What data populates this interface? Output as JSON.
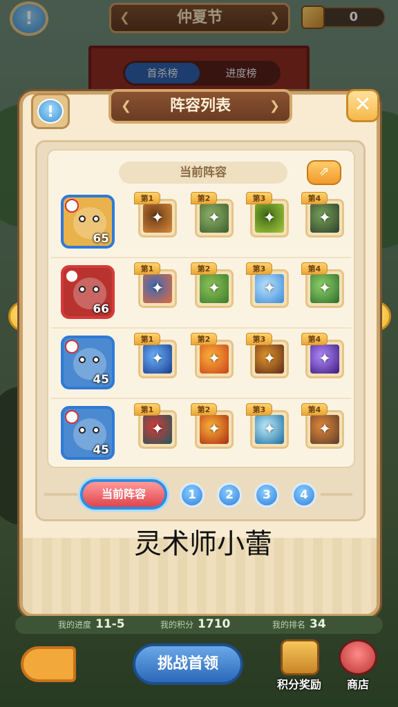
{
  "top_bar": {
    "title": "仲夏节",
    "currency_value": "0"
  },
  "leaderboard_tabs": [
    "首杀榜",
    "进度榜"
  ],
  "modal": {
    "title": "阵容列表",
    "section_title": "当前阵容",
    "caption": "灵术师小蕾",
    "pager": {
      "current_label": "当前阵容",
      "pages": [
        "1",
        "2",
        "3",
        "4"
      ]
    }
  },
  "lineup": [
    {
      "hero": "yellow-bird-hero",
      "level": "65",
      "frame_color": "#2f7ad6",
      "bg_color": "#e9b24a",
      "skills": [
        {
          "tag": "第1",
          "icon": "crystal-icon",
          "colors": [
            "#d88b3a",
            "#6b3a18"
          ]
        },
        {
          "tag": "第2",
          "icon": "axe-icon",
          "colors": [
            "#3c5b2a",
            "#8fb36a"
          ]
        },
        {
          "tag": "第3",
          "icon": "shield-icon",
          "colors": [
            "#a6c93a",
            "#3d6a1a"
          ]
        },
        {
          "tag": "第4",
          "icon": "dark-claw-icon",
          "colors": [
            "#2d3d2a",
            "#77a35a"
          ]
        }
      ]
    },
    {
      "hero": "blue-fish-hero",
      "level": "66",
      "frame_color": "#d63a3a",
      "bg_color": "#b8332f",
      "skills": [
        {
          "tag": "第1",
          "icon": "lion-icon",
          "colors": [
            "#e46a3a",
            "#3a6ab8"
          ]
        },
        {
          "tag": "第2",
          "icon": "goblin-icon",
          "colors": [
            "#3a7a2a",
            "#8fc45a"
          ]
        },
        {
          "tag": "第3",
          "icon": "spear-icon",
          "colors": [
            "#3a8ad6",
            "#bde3ff"
          ]
        },
        {
          "tag": "第4",
          "icon": "green-spear-icon",
          "colors": [
            "#2d6a2a",
            "#8fd46a"
          ]
        }
      ]
    },
    {
      "hero": "hippo-hero",
      "level": "45",
      "frame_color": "#2f7ad6",
      "bg_color": "#4b8ad0",
      "skills": [
        {
          "tag": "第1",
          "icon": "comet-icon",
          "colors": [
            "#1a3a8a",
            "#6ab4ff"
          ]
        },
        {
          "tag": "第2",
          "icon": "paw-icon",
          "colors": [
            "#c8401a",
            "#ffb43a"
          ]
        },
        {
          "tag": "第3",
          "icon": "dark-totem-icon",
          "colors": [
            "#5a2a1a",
            "#e4962a"
          ]
        },
        {
          "tag": "第4",
          "icon": "magic-circle-icon",
          "colors": [
            "#3a1a7a",
            "#b48aff"
          ]
        }
      ]
    },
    {
      "hero": "pig-sage-hero",
      "level": "45",
      "frame_color": "#2f7ad6",
      "bg_color": "#4b8ad0",
      "skills": [
        {
          "tag": "第1",
          "icon": "red-mask-icon",
          "colors": [
            "#1f5a5a",
            "#d63a3a"
          ]
        },
        {
          "tag": "第2",
          "icon": "fire-icon",
          "colors": [
            "#a82a10",
            "#ffb43a"
          ]
        },
        {
          "tag": "第3",
          "icon": "ice-staff-icon",
          "colors": [
            "#1a6a9a",
            "#bff0ff"
          ]
        },
        {
          "tag": "第4",
          "icon": "hammer-icon",
          "colors": [
            "#5a3a2a",
            "#e48a3a"
          ]
        }
      ]
    }
  ],
  "bottom_stats": [
    {
      "label": "我的进度",
      "value": "11-5"
    },
    {
      "label": "我的积分",
      "value": "1710"
    },
    {
      "label": "我的排名",
      "value": "34"
    }
  ],
  "bottom_buttons": {
    "challenge": "挑战首领",
    "reward": "积分奖励",
    "shop": "商店"
  }
}
